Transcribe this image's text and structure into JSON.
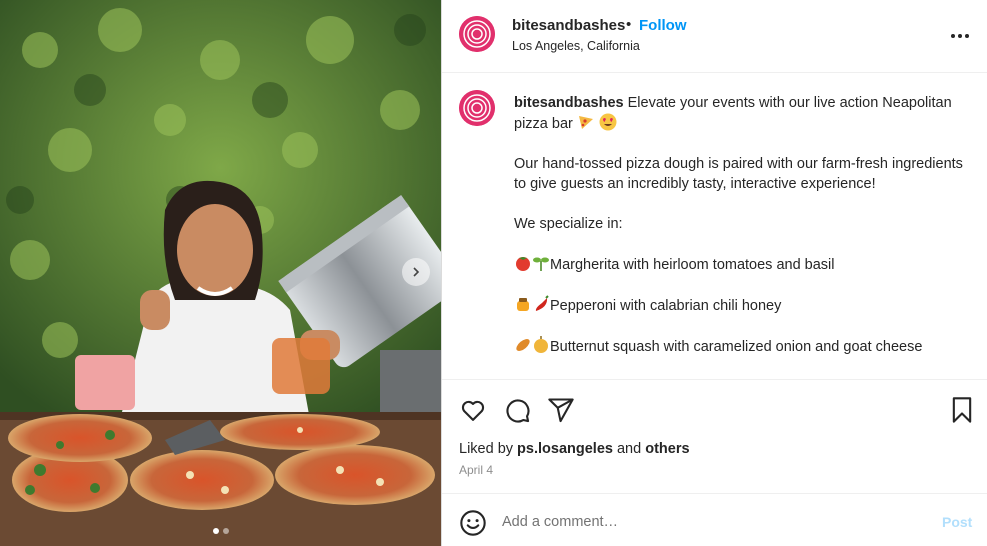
{
  "post_media": {
    "alt_icon": "photo",
    "next_icon": "chevron-right-icon",
    "carousel_dots": [
      true,
      false
    ]
  },
  "header": {
    "username": "bitesandbashes",
    "separator": "•",
    "follow_label": "Follow",
    "location": "Los Angeles, California",
    "more_icon": "more-options-icon"
  },
  "caption": {
    "username": "bitesandbashes",
    "line1": "Elevate your events with our live action Neapolitan pizza bar",
    "paragraph2": "Our hand-tossed pizza dough is paired with our farm-fresh ingredients to give guests an incredibly tasty, interactive experience!",
    "paragraph3": "We specialize in:",
    "items": [
      "Margherita with heirloom tomatoes and basil",
      "Pepperoni with calabrian chili honey",
      "Butternut squash with caramelized onion and goat cheese"
    ]
  },
  "actions": {
    "like_icon": "heart-icon",
    "comment_icon": "comment-icon",
    "share_icon": "share-icon",
    "save_icon": "bookmark-icon"
  },
  "likes": {
    "prefix": "Liked by",
    "user": "ps.losangeles",
    "and": "and",
    "others": "others"
  },
  "date": "April 4",
  "comment_box": {
    "placeholder": "Add a comment…",
    "post_label": "Post"
  },
  "colors": {
    "follow": "#0095f6",
    "post_disabled": "#b2dffc",
    "brand_avatar": "#e1306c"
  }
}
